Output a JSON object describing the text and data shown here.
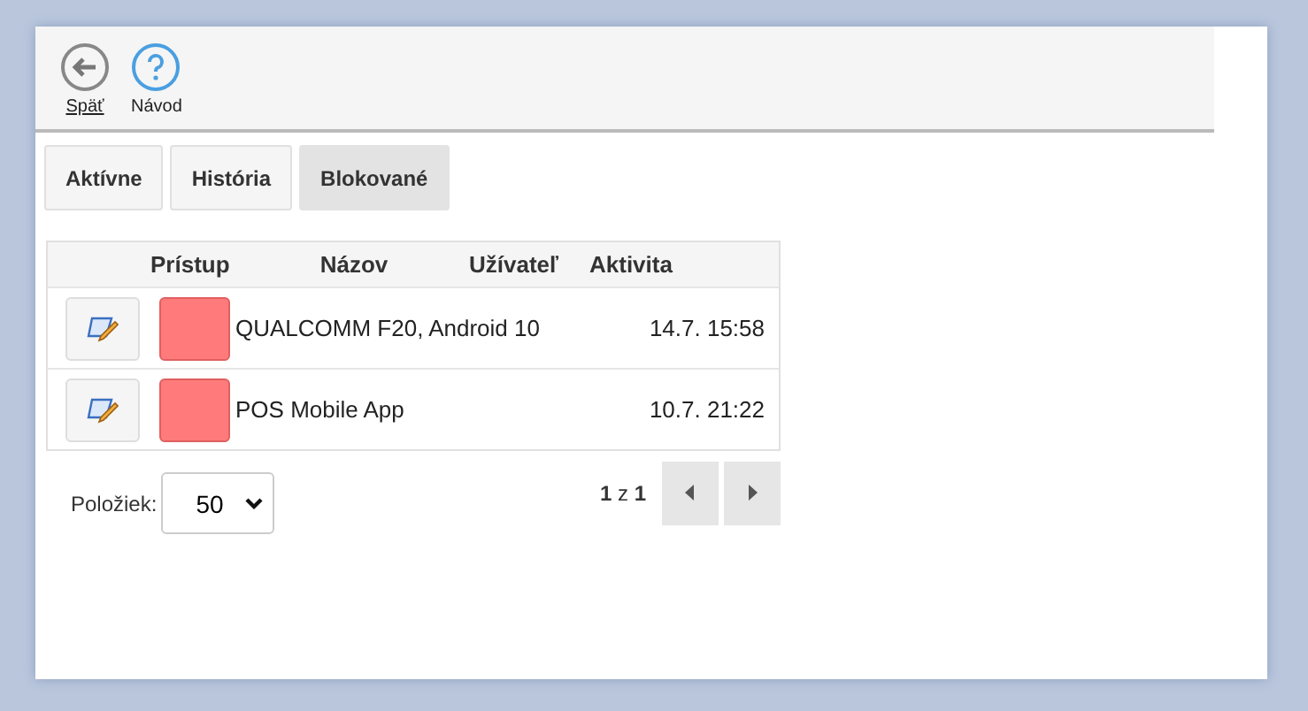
{
  "toolbar": [
    {
      "kind": "back",
      "label": "Späť"
    },
    {
      "kind": "help",
      "label": "Návod"
    }
  ],
  "tabs": [
    {
      "label": "Aktívne",
      "selected": false
    },
    {
      "label": "História",
      "selected": false
    },
    {
      "label": "Blokované",
      "selected": true
    }
  ],
  "table": {
    "columns": [
      "Prístup",
      "Názov",
      "Užívateľ",
      "Aktivita"
    ],
    "rows": [
      {
        "color": "#ff7b7b",
        "name": "QUALCOMM F20, Android 10",
        "activity": "14.7. 15:58"
      },
      {
        "color": "#ff7b7b",
        "name": "POS Mobile App",
        "activity": "10.7. 21:22"
      }
    ]
  },
  "footer": {
    "page_size_label": "Položiek:",
    "page_size": "50",
    "paging": "**1** z **1**"
  }
}
